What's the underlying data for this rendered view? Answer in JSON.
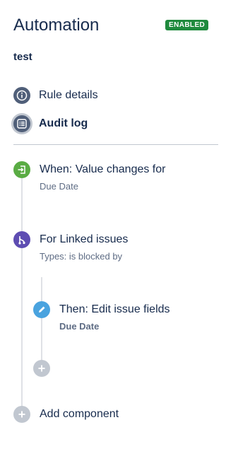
{
  "header": {
    "title": "Automation",
    "status_badge": "ENABLED",
    "rule_name": "test"
  },
  "nav": {
    "rule_details": "Rule details",
    "audit_log": "Audit log"
  },
  "flow": {
    "trigger": {
      "title": "When: Value changes for",
      "subtitle": "Due Date",
      "icon": "trigger-icon"
    },
    "branch": {
      "title": "For Linked issues",
      "subtitle": "Types: is blocked by",
      "icon": "branch-icon"
    },
    "action": {
      "title": "Then: Edit issue fields",
      "subtitle": "Due Date",
      "icon": "pencil-icon"
    },
    "add_component": "Add component"
  },
  "colors": {
    "enabled_badge": "#1f8a3d",
    "trigger": "#5aac44",
    "branch": "#5e4db2",
    "action": "#4aa3df",
    "nav_icon": "#505f79"
  }
}
